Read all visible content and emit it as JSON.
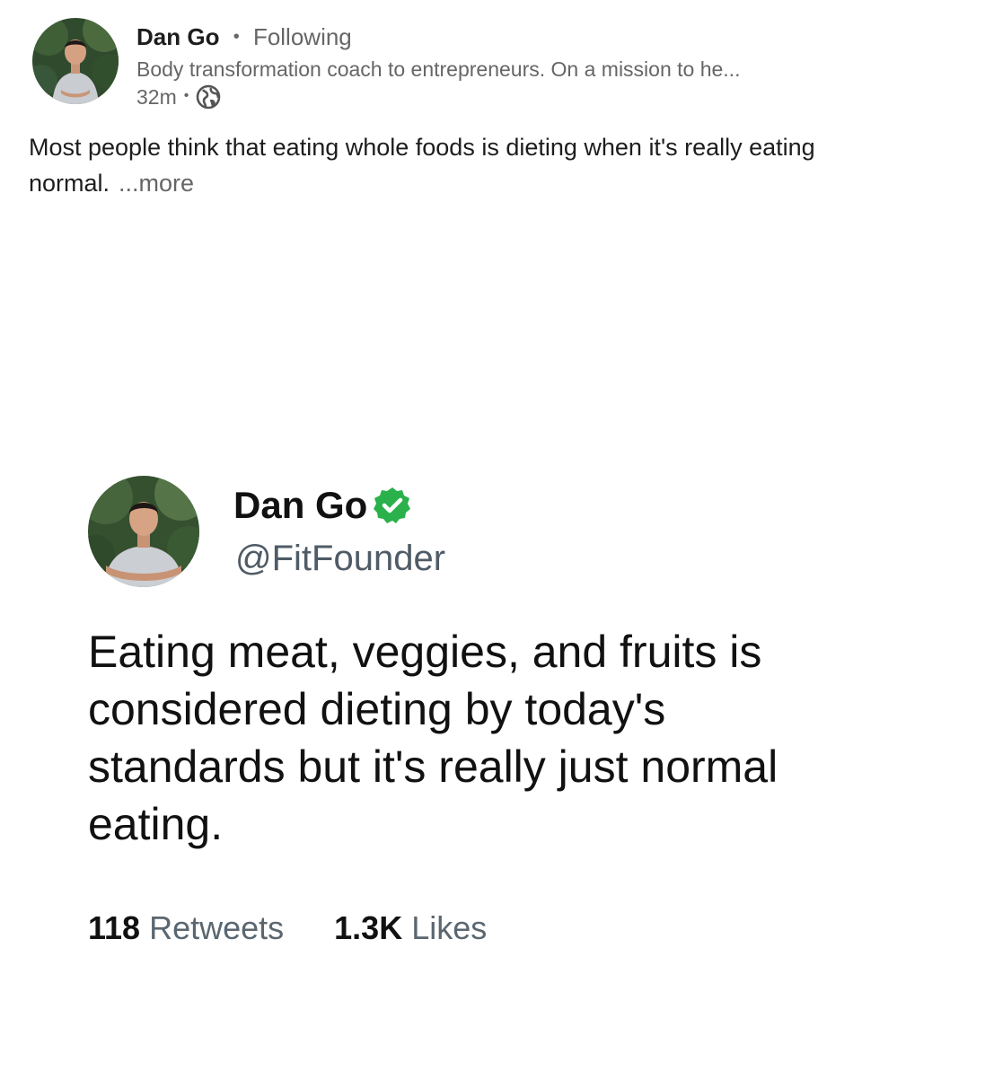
{
  "post": {
    "author_name": "Dan Go",
    "follow_status": "Following",
    "separator": "•",
    "headline": "Body transformation coach to entrepreneurs. On a mission to he...",
    "timestamp": "32m",
    "visibility_icon": "globe-icon",
    "text": "Most people think that eating whole foods is dieting when it's really eating normal.",
    "more_label": "...more"
  },
  "tweet": {
    "name": "Dan Go",
    "verified_icon": "verified-badge-icon",
    "verified_color": "#2bb14b",
    "handle": "@FitFounder",
    "text": "Eating meat, veggies, and fruits is considered dieting by today's standards but it's really just normal eating.",
    "retweets_count": "118",
    "retweets_label": "Retweets",
    "likes_count": "1.3K",
    "likes_label": "Likes"
  }
}
